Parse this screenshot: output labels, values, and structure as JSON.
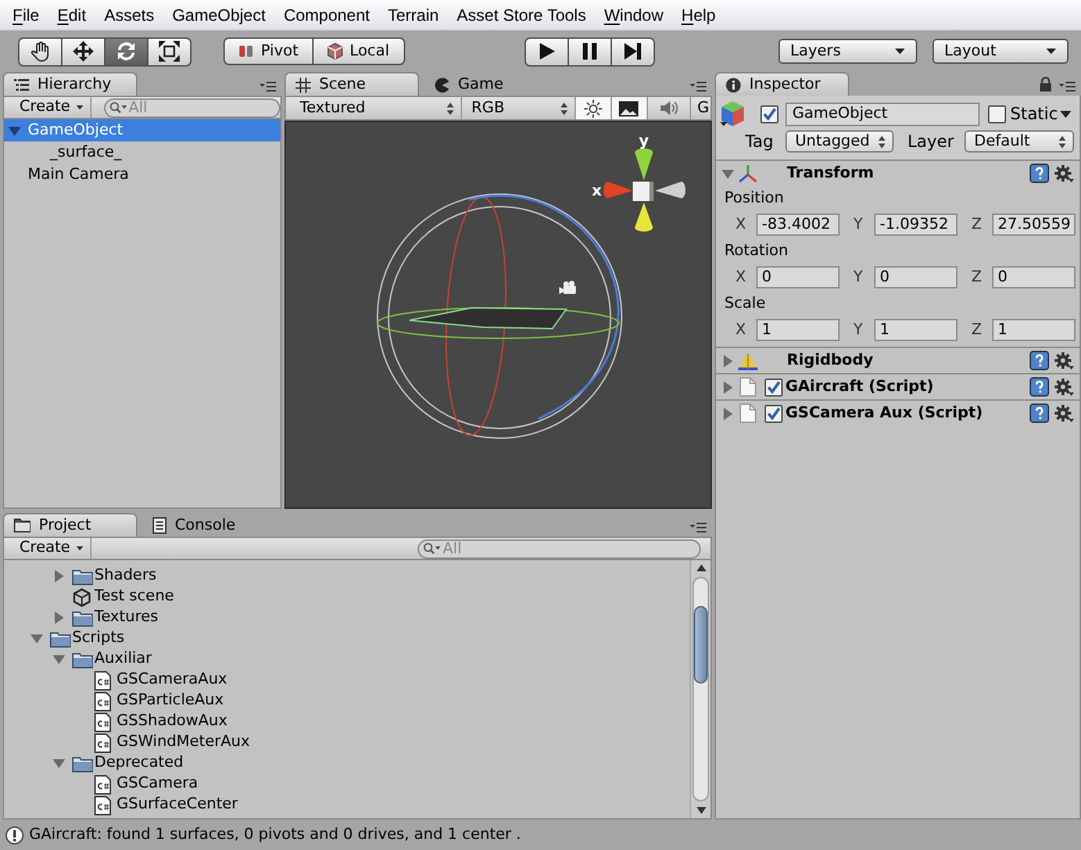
{
  "menu_bar": [
    {
      "label": "File",
      "mnemonic": true
    },
    {
      "label": "Edit",
      "mnemonic": true
    },
    {
      "label": "Assets",
      "mnemonic": false
    },
    {
      "label": "GameObject",
      "mnemonic": false
    },
    {
      "label": "Component",
      "mnemonic": false
    },
    {
      "label": "Terrain",
      "mnemonic": false
    },
    {
      "label": "Asset Store Tools",
      "mnemonic": false
    },
    {
      "label": "Window",
      "mnemonic": true
    },
    {
      "label": "Help",
      "mnemonic": true
    }
  ],
  "toolbar": {
    "tools": [
      {
        "kind": "hand",
        "selected": false
      },
      {
        "kind": "move",
        "selected": false
      },
      {
        "kind": "rotate",
        "selected": true
      },
      {
        "kind": "scale",
        "selected": false
      }
    ],
    "pivot_mode": [
      {
        "kind": "pivot",
        "label": "Pivot"
      },
      {
        "kind": "local",
        "label": "Local"
      }
    ],
    "layers": "Layers",
    "layout": "Layout"
  },
  "hierarchy": {
    "tabs": [
      {
        "label": "Hierarchy",
        "selected": true
      }
    ],
    "create": "Create",
    "search": {
      "placeholder": "All"
    },
    "items": [
      {
        "label": "GameObject",
        "selected": true,
        "expanded": true,
        "children": [
          {
            "label": "_surface_",
            "selected": false
          }
        ]
      },
      {
        "label": "Main Camera",
        "selected": false
      }
    ]
  },
  "scene": {
    "tabs": [
      {
        "kind": "scene",
        "label": "Scene",
        "selected": true
      },
      {
        "kind": "game",
        "label": "Game",
        "selected": false
      }
    ],
    "draw_mode": "Textured",
    "channel": "RGB",
    "toggles": [
      {
        "kind": "lighting",
        "on": true
      },
      {
        "kind": "image",
        "on": true
      },
      {
        "kind": "audio",
        "on": false
      }
    ],
    "gizmos": "G",
    "axis_labels": [
      {
        "kind": "y",
        "label": "y"
      },
      {
        "kind": "x",
        "label": "x"
      }
    ]
  },
  "inspector": {
    "tabs": [
      {
        "label": "Inspector",
        "selected": true
      }
    ],
    "object": {
      "active": true,
      "name": "GameObject",
      "static": false,
      "static_label": "Static",
      "tag_label": "Tag",
      "tag": "Untagged",
      "layer_label": "Layer",
      "layer": "Default"
    },
    "components": [
      {
        "kind": "transform",
        "title": "Transform",
        "expanded": true,
        "properties": [
          {
            "label": "Position",
            "fields": [
              {
                "axis": "X",
                "value": "-83.4002"
              },
              {
                "axis": "Y",
                "value": "-1.09352"
              },
              {
                "axis": "Z",
                "value": "27.50559"
              }
            ]
          },
          {
            "label": "Rotation",
            "fields": [
              {
                "axis": "X",
                "value": "0"
              },
              {
                "axis": "Y",
                "value": "0"
              },
              {
                "axis": "Z",
                "value": "0"
              }
            ]
          },
          {
            "label": "Scale",
            "fields": [
              {
                "axis": "X",
                "value": "1"
              },
              {
                "axis": "Y",
                "value": "1"
              },
              {
                "axis": "Z",
                "value": "1"
              }
            ]
          }
        ]
      },
      {
        "kind": "rigidbody",
        "title": "Rigidbody",
        "expanded": false
      },
      {
        "kind": "script",
        "title": "GAircraft (Script)",
        "expanded": false,
        "enabled": true
      },
      {
        "kind": "script",
        "title": "GSCamera Aux (Script)",
        "expanded": false,
        "enabled": true
      }
    ]
  },
  "project": {
    "tabs": [
      {
        "kind": "project",
        "label": "Project",
        "selected": true
      },
      {
        "kind": "console",
        "label": "Console",
        "selected": false
      }
    ],
    "create": "Create",
    "search": {
      "placeholder": "All"
    },
    "tree": [
      {
        "children": [
          {
            "kind": "folder",
            "label": "Shaders",
            "expanded": false
          },
          {
            "kind": "scene",
            "label": "Test scene"
          },
          {
            "kind": "folder",
            "label": "Textures",
            "expanded": false
          }
        ]
      },
      {
        "kind": "folder",
        "label": "Scripts",
        "expanded": true,
        "children": [
          {
            "kind": "folder",
            "label": "Auxiliar",
            "expanded": true,
            "children": [
              {
                "kind": "script",
                "label": "GSCameraAux"
              },
              {
                "kind": "script",
                "label": "GSParticleAux"
              },
              {
                "kind": "script",
                "label": "GSShadowAux"
              },
              {
                "kind": "script",
                "label": "GSWindMeterAux"
              }
            ]
          },
          {
            "kind": "folder",
            "label": "Deprecated",
            "expanded": true,
            "children": [
              {
                "kind": "script",
                "label": "GSCamera"
              },
              {
                "kind": "script",
                "label": "GSurfaceCenter"
              }
            ]
          }
        ]
      }
    ]
  },
  "status_bar": {
    "message": "GAircraft: found 1 surfaces, 0 pivots and 0 drives, and 1 center ."
  }
}
